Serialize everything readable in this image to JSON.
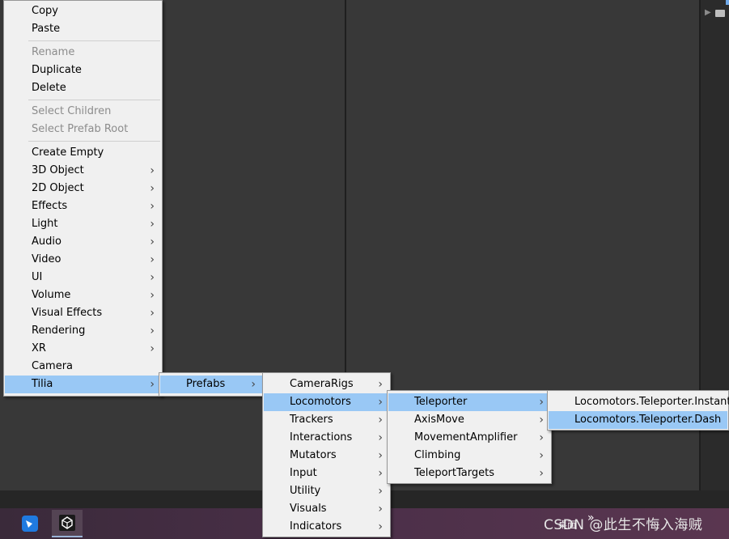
{
  "main_menu": {
    "items": [
      {
        "label": "Copy",
        "disabled": false,
        "submenu": false
      },
      {
        "label": "Paste",
        "disabled": false,
        "submenu": false
      },
      {
        "label": "Rename",
        "disabled": true,
        "submenu": false
      },
      {
        "label": "Duplicate",
        "disabled": false,
        "submenu": false
      },
      {
        "label": "Delete",
        "disabled": false,
        "submenu": false
      },
      {
        "label": "Select Children",
        "disabled": true,
        "submenu": false
      },
      {
        "label": "Select Prefab Root",
        "disabled": true,
        "submenu": false
      },
      {
        "label": "Create Empty",
        "disabled": false,
        "submenu": false
      },
      {
        "label": "3D Object",
        "disabled": false,
        "submenu": true
      },
      {
        "label": "2D Object",
        "disabled": false,
        "submenu": true
      },
      {
        "label": "Effects",
        "disabled": false,
        "submenu": true
      },
      {
        "label": "Light",
        "disabled": false,
        "submenu": true
      },
      {
        "label": "Audio",
        "disabled": false,
        "submenu": true
      },
      {
        "label": "Video",
        "disabled": false,
        "submenu": true
      },
      {
        "label": "UI",
        "disabled": false,
        "submenu": true
      },
      {
        "label": "Volume",
        "disabled": false,
        "submenu": true
      },
      {
        "label": "Visual Effects",
        "disabled": false,
        "submenu": true
      },
      {
        "label": "Rendering",
        "disabled": false,
        "submenu": true
      },
      {
        "label": "XR",
        "disabled": false,
        "submenu": true
      },
      {
        "label": "Camera",
        "disabled": false,
        "submenu": false
      },
      {
        "label": "Tilia",
        "disabled": false,
        "submenu": true,
        "highlighted": true
      }
    ]
  },
  "tilia_menu": {
    "items": [
      {
        "label": "Prefabs",
        "submenu": true,
        "highlighted": true
      }
    ]
  },
  "prefabs_menu": {
    "items": [
      {
        "label": "CameraRigs",
        "submenu": true
      },
      {
        "label": "Locomotors",
        "submenu": true,
        "highlighted": true
      },
      {
        "label": "Trackers",
        "submenu": true
      },
      {
        "label": "Interactions",
        "submenu": true
      },
      {
        "label": "Mutators",
        "submenu": true
      },
      {
        "label": "Input",
        "submenu": true
      },
      {
        "label": "Utility",
        "submenu": true
      },
      {
        "label": "Visuals",
        "submenu": true
      },
      {
        "label": "Indicators",
        "submenu": true
      }
    ]
  },
  "locomotors_menu": {
    "items": [
      {
        "label": "Teleporter",
        "submenu": true,
        "highlighted": true
      },
      {
        "label": "AxisMove",
        "submenu": true
      },
      {
        "label": "MovementAmplifier",
        "submenu": true
      },
      {
        "label": "Climbing",
        "submenu": true
      },
      {
        "label": "TeleportTargets",
        "submenu": true
      }
    ]
  },
  "teleporter_menu": {
    "items": [
      {
        "label": "Locomotors.Teleporter.Instant",
        "submenu": false
      },
      {
        "label": "Locomotors.Teleporter.Dash",
        "submenu": false,
        "highlighted": true
      }
    ]
  },
  "taskbar": {
    "apps": [
      {
        "icon": "feishu-app-icon"
      },
      {
        "icon": "unity-app-icon",
        "active": true
      }
    ],
    "tray_chevron": "»",
    "tray_text": "桌面"
  },
  "watermark": "CSDN @此生不悔入海贼",
  "colors": {
    "editor_bg": "#383838",
    "menu_bg": "#f0f0f0",
    "highlight": "#99c8f5",
    "disabled_text": "#8c8c8c"
  }
}
